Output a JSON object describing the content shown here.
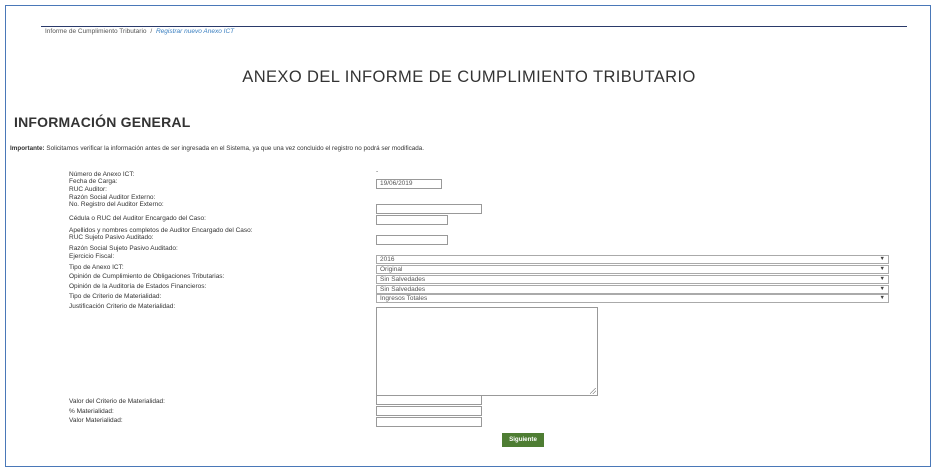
{
  "breadcrumb": {
    "root": "Informe de Cumplimiento Tributario",
    "separator": "/",
    "current": "Registrar nuevo Anexo ICT"
  },
  "page_title": "ANEXO DEL INFORME DE CUMPLIMIENTO TRIBUTARIO",
  "section_title": "INFORMACIÓN GENERAL",
  "notice": {
    "bold": "Importante:",
    "text": " Solicitamos verificar la información antes de ser ingresada en el Sistema, ya que una vez concluido el registro no podrá ser modificada."
  },
  "form": {
    "numero_anexo": {
      "label": "Número de Anexo ICT:",
      "value": "-"
    },
    "fecha_carga": {
      "label": "Fecha de Carga:",
      "value": "19/06/2019"
    },
    "ruc_auditor": {
      "label": "RUC Auditor:"
    },
    "razon_social_auditor": {
      "label": "Razón Social Auditor Externo:"
    },
    "registro_auditor": {
      "label": "No. Registro del Auditor Externo:",
      "value": ""
    },
    "cedula_auditor": {
      "label": "Cédula o RUC del Auditor Encargado del Caso:",
      "value": ""
    },
    "nombres_auditor": {
      "label": "Apellidos y nombres completos de Auditor Encargado del Caso:"
    },
    "ruc_sujeto": {
      "label": "RUC Sujeto Pasivo Auditado:",
      "value": ""
    },
    "razon_social_sujeto": {
      "label": "Razón Social Sujeto Pasivo Auditado:"
    },
    "ejercicio_fiscal": {
      "label": "Ejercicio Fiscal:",
      "value": "2016"
    },
    "tipo_anexo": {
      "label": "Tipo de Anexo ICT:",
      "value": "Original"
    },
    "opinion_cumplimiento": {
      "label": "Opinión de Cumplimiento de Obligaciones Tributarias:",
      "value": "Sin Salvedades"
    },
    "opinion_auditoria": {
      "label": "Opinión de la Auditoría de Estados Financieros:",
      "value": "Sin Salvedades"
    },
    "tipo_criterio": {
      "label": "Tipo de Criterio de Materialidad:",
      "value": "Ingresos Totales"
    },
    "justificacion": {
      "label": "Justificación Criterio de Materialidad:",
      "value": ""
    },
    "valor_criterio": {
      "label": "Valor del Criterio de Materialidad:",
      "value": ""
    },
    "porcentaje_materialidad": {
      "label": "% Materialidad:",
      "value": ""
    },
    "valor_materialidad": {
      "label": "Valor Materialidad:",
      "value": ""
    }
  },
  "buttons": {
    "next": "Siguiente"
  },
  "icons": {
    "dropdown": "chevron-down-icon",
    "resize": "resize-grip-icon"
  },
  "colors": {
    "frame_border": "#4a78b8",
    "link": "#3a7fc0",
    "primary_button": "#4e7d33"
  }
}
